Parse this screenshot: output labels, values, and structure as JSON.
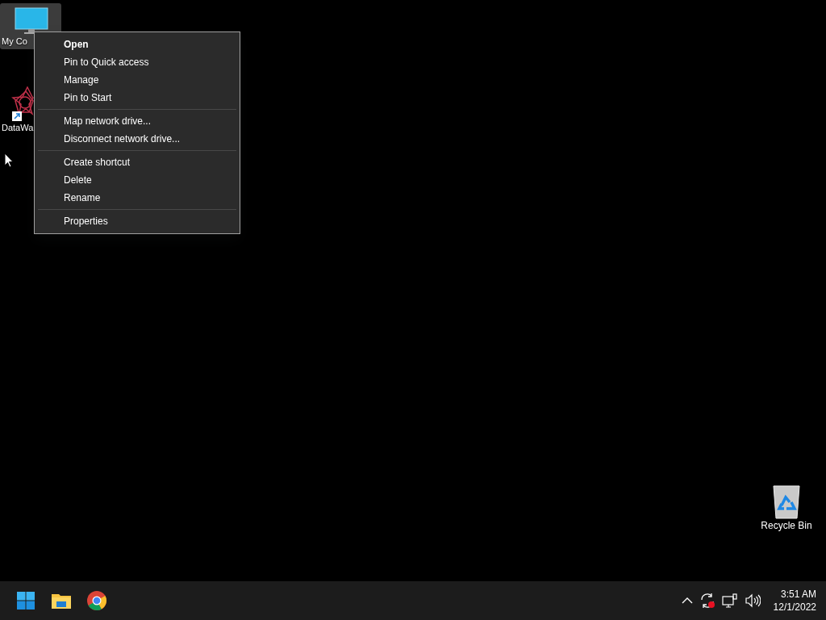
{
  "desktop_icons": [
    {
      "label": "My Co",
      "kind": "computer",
      "selected": true
    },
    {
      "label": "DataWa",
      "kind": "app-shortcut",
      "selected": false
    },
    {
      "label": "Recycle Bin",
      "kind": "recycle-bin",
      "selected": false
    }
  ],
  "context_menu": {
    "groups": [
      [
        {
          "label": "Open",
          "default": true
        },
        {
          "label": "Pin to Quick access",
          "default": false
        },
        {
          "label": "Manage",
          "default": false
        },
        {
          "label": "Pin to Start",
          "default": false
        }
      ],
      [
        {
          "label": "Map network drive...",
          "default": false
        },
        {
          "label": "Disconnect network drive...",
          "default": false
        }
      ],
      [
        {
          "label": "Create shortcut",
          "default": false
        },
        {
          "label": "Delete",
          "default": false
        },
        {
          "label": "Rename",
          "default": false
        }
      ],
      [
        {
          "label": "Properties",
          "default": false
        }
      ]
    ]
  },
  "taskbar": {
    "apps": [
      {
        "kind": "start"
      },
      {
        "kind": "files"
      },
      {
        "kind": "browser"
      }
    ],
    "tray": [
      {
        "kind": "chevron"
      },
      {
        "kind": "sync-alert"
      },
      {
        "kind": "network"
      },
      {
        "kind": "volume"
      }
    ],
    "time": "3:51 AM",
    "date": "12/1/2022"
  }
}
